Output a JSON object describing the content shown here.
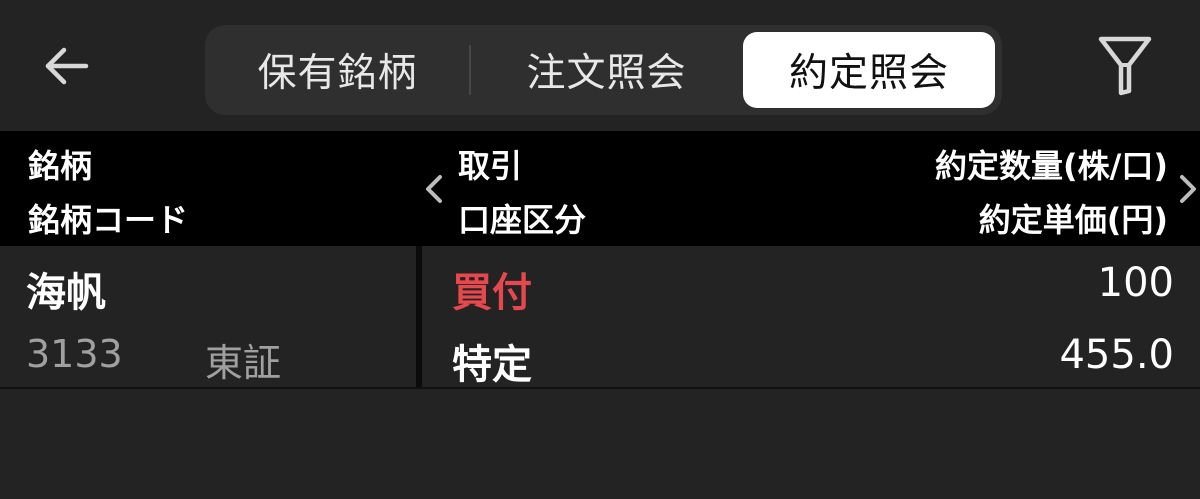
{
  "nav": {
    "back_icon": "arrow-left-icon",
    "tabs": [
      {
        "label": "保有銘柄",
        "selected": false
      },
      {
        "label": "注文照会",
        "selected": false
      },
      {
        "label": "約定照会",
        "selected": true
      }
    ],
    "filter_icon": "funnel-icon"
  },
  "table": {
    "columns": {
      "col1_line1": "銘柄",
      "col1_line2": "銘柄コード",
      "col2_line1": "取引",
      "col2_line2": "口座区分",
      "col3_line1": "約定数量(株/口)",
      "col3_line2": "約定単価(円)"
    },
    "rows": [
      {
        "name": "海帆",
        "code": "3133",
        "market": "東証",
        "trade": "買付",
        "account": "特定",
        "quantity": "100",
        "price": "455.0"
      }
    ]
  },
  "colors": {
    "background": "#232323",
    "header_bg": "#000000",
    "buy": "#e5484d",
    "muted": "#a0a0a0"
  }
}
